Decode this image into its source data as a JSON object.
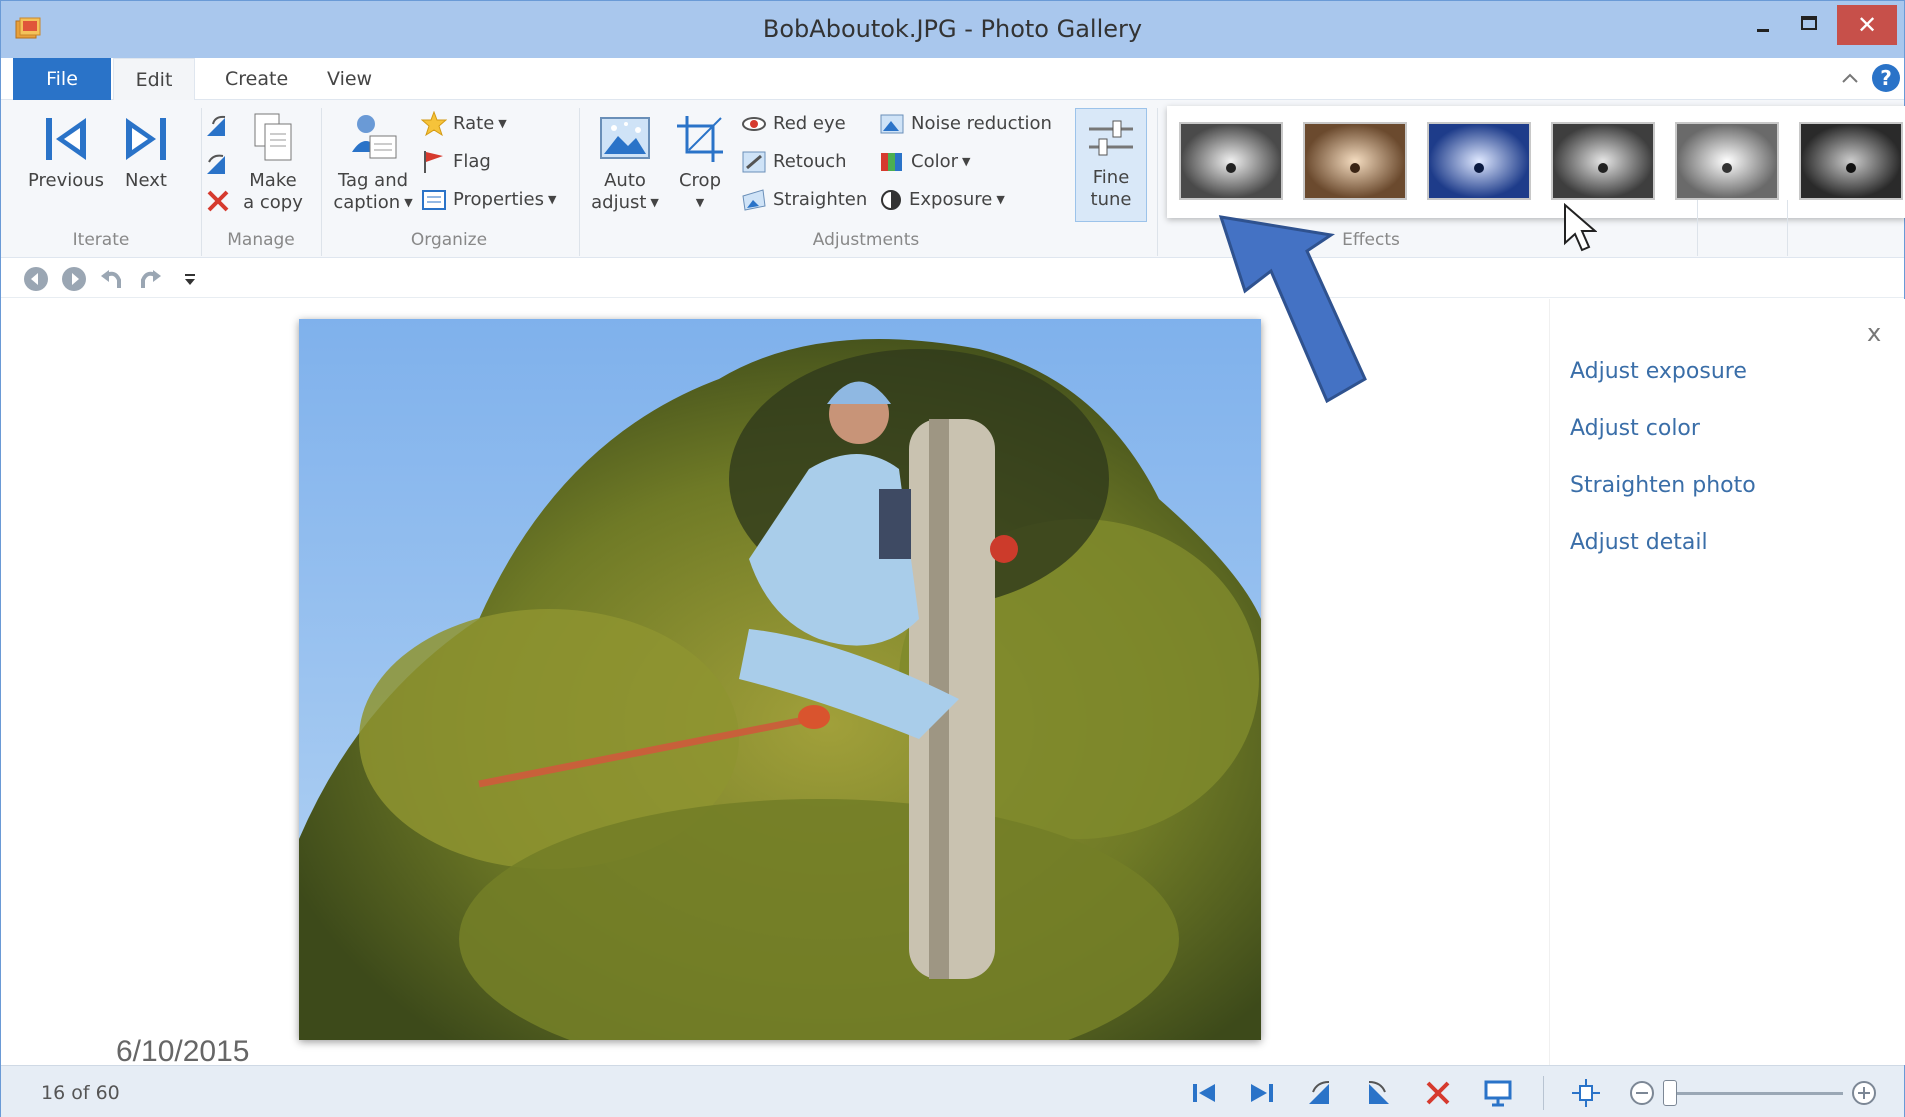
{
  "window": {
    "title": "BobAboutok.JPG - Photo Gallery",
    "controls": {
      "minimize": "–",
      "maximize": "□",
      "close": "✕"
    }
  },
  "tabs": [
    {
      "label": "File"
    },
    {
      "label": "Edit"
    },
    {
      "label": "Create"
    },
    {
      "label": "View"
    }
  ],
  "ribbon": {
    "iterate": {
      "label": "Iterate",
      "previous": "Previous",
      "next": "Next"
    },
    "manage": {
      "label": "Manage",
      "make_copy_1": "Make",
      "make_copy_2": "a copy"
    },
    "organize": {
      "label": "Organize",
      "tag_1": "Tag and",
      "tag_2": "caption",
      "rate": "Rate",
      "flag": "Flag",
      "properties": "Properties"
    },
    "adjustments": {
      "label": "Adjustments",
      "auto_1": "Auto",
      "auto_2": "adjust",
      "crop": "Crop",
      "red_eye": "Red eye",
      "retouch": "Retouch",
      "straighten": "Straighten",
      "noise_reduction": "Noise reduction",
      "color": "Color",
      "exposure": "Exposure",
      "fine_1": "Fine",
      "fine_2": "tune"
    },
    "effects": {
      "label": "Effects"
    }
  },
  "side_panel": {
    "close": "x",
    "links": [
      "Adjust exposure",
      "Adjust color",
      "Straighten photo",
      "Adjust detail"
    ]
  },
  "date_label": "6/10/2015",
  "status": {
    "count": "16 of 60"
  },
  "colors": {
    "title_bar": "#a9c7ed",
    "file_tab": "#2a73c8",
    "arrow": "#4472c4",
    "close_button": "#c7504a"
  }
}
